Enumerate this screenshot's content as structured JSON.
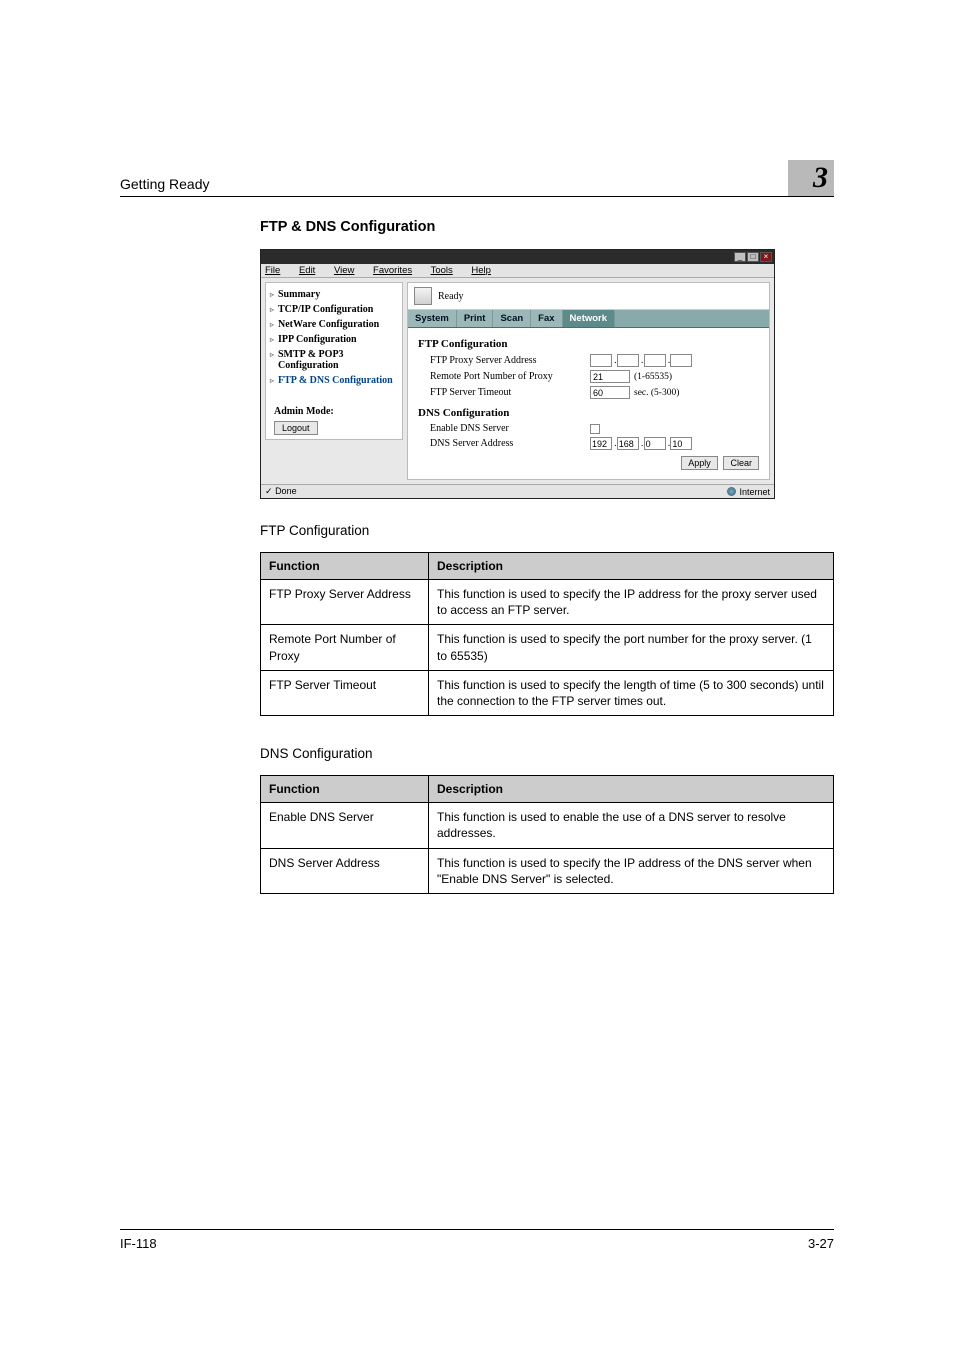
{
  "header": {
    "breadcrumb": "Getting Ready",
    "chapter": "3"
  },
  "section_title": "FTP & DNS Configuration",
  "screenshot": {
    "menubar": [
      "File",
      "Edit",
      "View",
      "Favorites",
      "Tools",
      "Help"
    ],
    "status_text": "Ready",
    "tabs": {
      "items": [
        "System",
        "Print",
        "Scan",
        "Fax",
        "Network"
      ],
      "active": "Network"
    },
    "sidebar": {
      "items": [
        "Summary",
        "TCP/IP Configuration",
        "NetWare Configuration",
        "IPP Configuration",
        "SMTP & POP3 Configuration",
        "FTP & DNS Configuration"
      ],
      "admin_label": "Admin Mode:",
      "logout_label": "Logout"
    },
    "ftp_section": {
      "title": "FTP Configuration",
      "proxy_addr_label": "FTP Proxy Server Address",
      "remote_port_label": "Remote Port Number of Proxy",
      "remote_port_value": "21",
      "remote_port_hint": "(1-65535)",
      "timeout_label": "FTP Server Timeout",
      "timeout_value": "60",
      "timeout_hint": "sec. (5-300)"
    },
    "dns_section": {
      "title": "DNS Configuration",
      "enable_label": "Enable DNS Server",
      "addr_label": "DNS Server Address",
      "addr_values": [
        "192",
        "168",
        "0",
        "10"
      ]
    },
    "buttons": {
      "apply": "Apply",
      "clear": "Clear"
    },
    "statusbar": {
      "left": "Done",
      "right": "Internet"
    }
  },
  "ftp_config_heading": "FTP Configuration",
  "ftp_table": {
    "headers": {
      "function": "Function",
      "description": "Description"
    },
    "rows": [
      {
        "func": "FTP Proxy Server Address",
        "desc": "This function is used to specify the IP address for the proxy server used to access an FTP server."
      },
      {
        "func": "Remote Port Number of Proxy",
        "desc": "This function is used to specify the port number for the proxy server. (1 to 65535)"
      },
      {
        "func": "FTP Server Timeout",
        "desc": "This function is used to specify the length of time (5 to 300 seconds) until the connection to the FTP server times out."
      }
    ]
  },
  "dns_config_heading": "DNS Configuration",
  "dns_table": {
    "headers": {
      "function": "Function",
      "description": "Description"
    },
    "rows": [
      {
        "func": "Enable DNS Server",
        "desc": "This function is used to enable the use of a DNS server to resolve addresses."
      },
      {
        "func": "DNS Server Address",
        "desc": "This function is used to specify the IP address of the DNS server when \"Enable DNS Server\" is selected."
      }
    ]
  },
  "footer": {
    "left": "IF-118",
    "right": "3-27"
  }
}
